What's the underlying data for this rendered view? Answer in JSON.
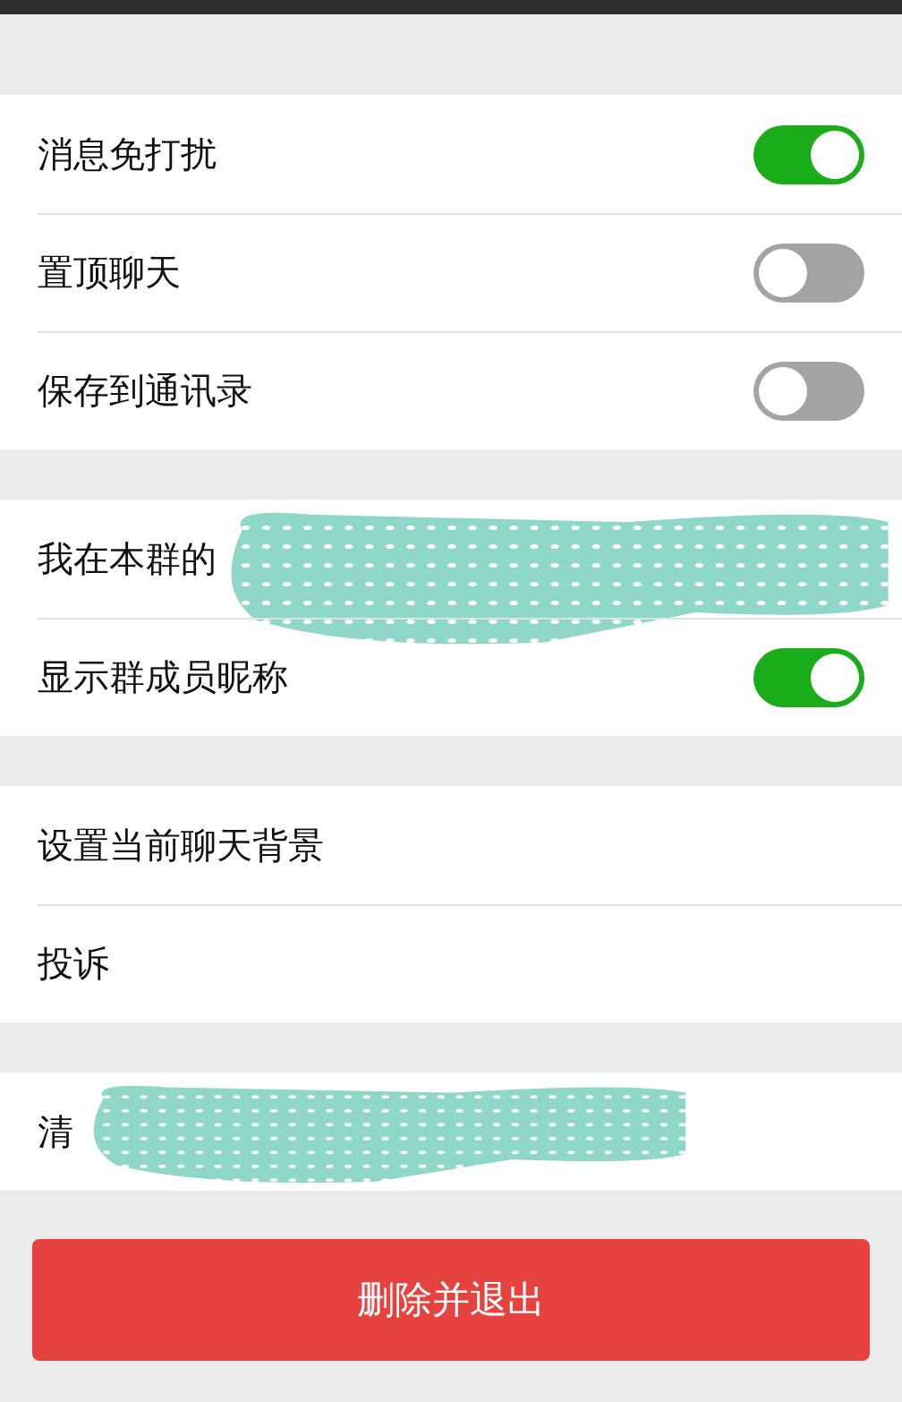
{
  "groups": [
    {
      "rows": [
        {
          "kind": "toggle",
          "label": "消息免打扰",
          "on": true
        },
        {
          "kind": "toggle",
          "label": "置顶聊天",
          "on": false
        },
        {
          "kind": "toggle",
          "label": "保存到通讯录",
          "on": false
        }
      ]
    },
    {
      "rows": [
        {
          "kind": "plain",
          "label": "我在本群的",
          "redacted": true
        },
        {
          "kind": "toggle",
          "label": "显示群成员昵称",
          "on": true
        }
      ]
    },
    {
      "rows": [
        {
          "kind": "plain",
          "label": "设置当前聊天背景"
        },
        {
          "kind": "plain",
          "label": "投诉"
        }
      ]
    },
    {
      "rows": [
        {
          "kind": "plain",
          "label": "清",
          "redacted": true
        }
      ]
    }
  ],
  "delete_button": "删除并退出"
}
